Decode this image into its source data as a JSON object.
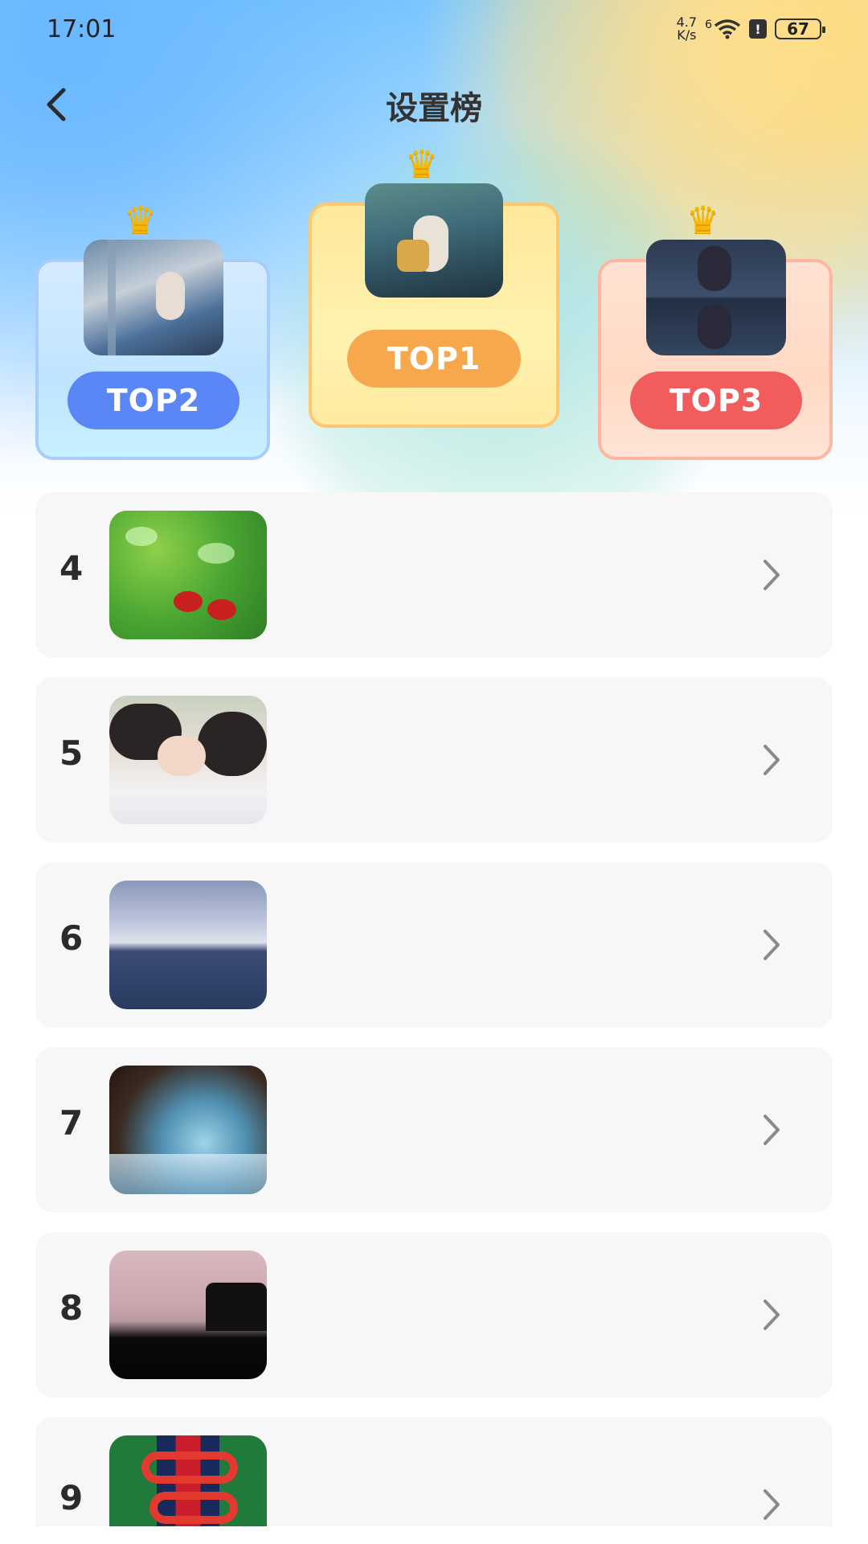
{
  "status": {
    "time": "17:01",
    "net_value": "4.7",
    "net_unit": "K/s",
    "wifi_label": "6",
    "battery": "67"
  },
  "header": {
    "title": "设置榜"
  },
  "podium": [
    {
      "label": "TOP2"
    },
    {
      "label": "TOP1"
    },
    {
      "label": "TOP3"
    }
  ],
  "list": [
    {
      "rank": "4",
      "image": "green-leaf-with-ladybugs"
    },
    {
      "rank": "5",
      "image": "two-girls-portrait"
    },
    {
      "rank": "6",
      "image": "sea-and-mountains"
    },
    {
      "rank": "7",
      "image": "waterfall-rocks"
    },
    {
      "rank": "8",
      "image": "sunset-silhouette"
    },
    {
      "rank": "9",
      "image": "red-snake-on-green"
    }
  ],
  "colors": {
    "top1": "#f7a84c",
    "top2": "#5b86f5",
    "top3": "#f25c5c",
    "title": "#333333",
    "row_bg": "#f7f7f7"
  }
}
